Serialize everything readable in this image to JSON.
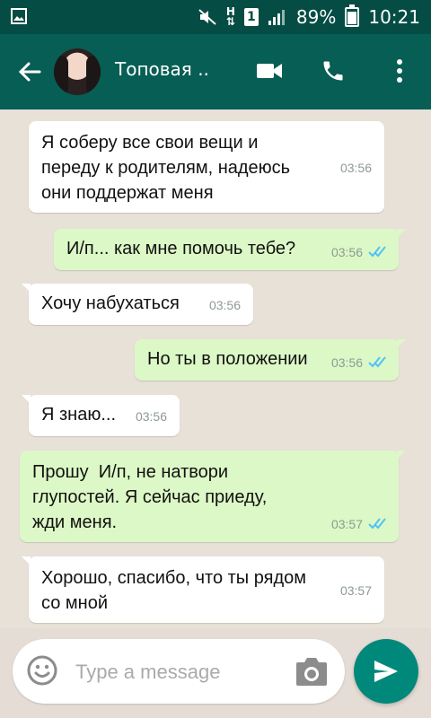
{
  "status_bar": {
    "network_label": "H",
    "sim_label": "1",
    "battery": "89%",
    "time": "10:21"
  },
  "header": {
    "contact_name": "Топовая ..",
    "back_icon": "arrow-left-icon",
    "video_icon": "video-call-icon",
    "call_icon": "phone-icon",
    "more_icon": "more-vert-icon"
  },
  "messages": [
    {
      "direction": "in",
      "text": "Я соберу все свои вещи и\nпереду к родителям, надеюсь\nони поддержат меня",
      "time": "03:56"
    },
    {
      "direction": "out",
      "text": "И/п... как мне помочь тебе?",
      "time": "03:56",
      "status": "read"
    },
    {
      "direction": "in",
      "text": "Хочу набухаться",
      "time": "03:56"
    },
    {
      "direction": "out",
      "text": "Но ты в положении",
      "time": "03:56",
      "status": "read"
    },
    {
      "direction": "in",
      "text": "Я знаю...",
      "time": "03:56"
    },
    {
      "direction": "out",
      "text": "Прошу  И/п, не натвори\nглупостей. Я сейчас приеду,\nжди меня.",
      "time": "03:57",
      "status": "read"
    },
    {
      "direction": "in",
      "text": "Хорошо, спасибо, что ты рядом\nсо мной",
      "time": "03:57"
    }
  ],
  "composer": {
    "placeholder": "Type a message",
    "emoji_icon": "emoji-icon",
    "camera_icon": "camera-icon",
    "send_icon": "send-icon"
  },
  "colors": {
    "header": "#075e54",
    "status_bar": "#054d44",
    "outgoing_bubble": "#dcf8c6",
    "incoming_bubble": "#ffffff",
    "send_button": "#00897b",
    "read_ticks": "#4fc3f7"
  }
}
